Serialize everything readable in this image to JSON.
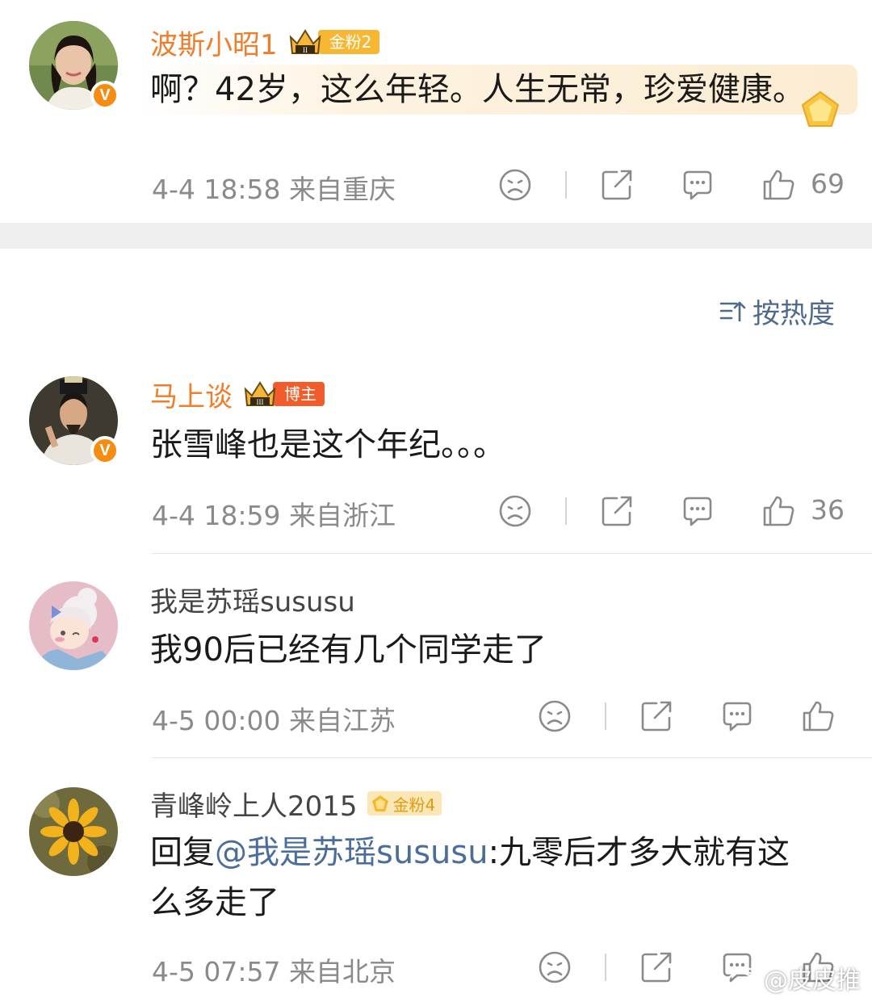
{
  "comments": [
    {
      "username": "波斯小昭1",
      "badge": {
        "type": "crown",
        "level": "II",
        "label": "金粉2"
      },
      "text": "啊？42岁，这么年轻。人生无常，珍爱健康。",
      "time": "4-4 18:58",
      "location": "来自重庆",
      "likes": "69",
      "verified": true
    },
    {
      "username": "马上谈",
      "badge": {
        "type": "crown",
        "level": "III",
        "label": "博主"
      },
      "text": "张雪峰也是这个年纪。。。",
      "time": "4-4 18:59",
      "location": "来自浙江",
      "likes": "36",
      "verified": true
    },
    {
      "username": "我是苏瑶sususu",
      "text": "我90后已经有几个同学走了",
      "time": "4-5 00:00",
      "location": "来自江苏",
      "likes": ""
    },
    {
      "username": "青峰岭上人2015",
      "badge": {
        "type": "fan",
        "label": "金粉4"
      },
      "reply_prefix": "回复",
      "mention": "@我是苏瑶sususu",
      "text_line1_rest": ":九零后才多大就有这",
      "text_line2": "么多走了",
      "time": "4-5 07:57",
      "location": "来自北京",
      "likes": ""
    }
  ],
  "sort": {
    "label": "按热度"
  },
  "watermark": "@皮皮推",
  "icons": {
    "verified": "V",
    "actions": [
      "dislike-face-icon",
      "share-icon",
      "comment-icon",
      "like-thumb-icon"
    ]
  },
  "colors": {
    "username_orange": "#ef7d2a",
    "username_plain": "#444444",
    "meta_gray": "#8a8a8a",
    "mention_blue": "#4a6d9c",
    "badge_gold": "#f7b733",
    "badge_red": "#f25c2d",
    "verified_orange": "#f78c13"
  }
}
